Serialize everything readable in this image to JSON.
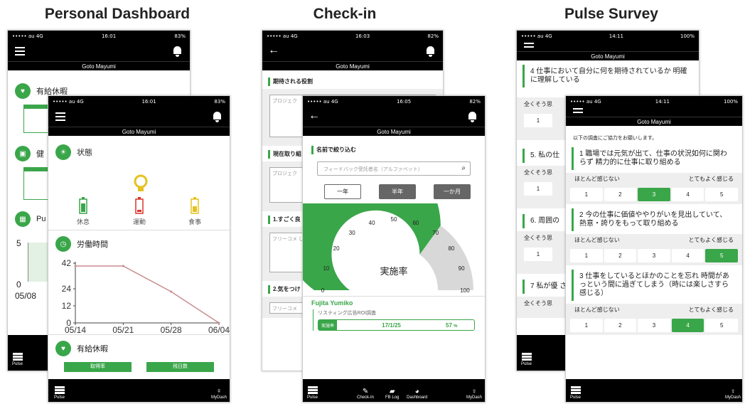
{
  "titles": {
    "left": "Personal Dashboard",
    "mid": "Check-in",
    "right": "Pulse Survey"
  },
  "status": {
    "carrier": "••••• au  4G",
    "time_a": "16:01",
    "bat_a": "83%",
    "time_c": "16:03",
    "bat_c": "82%",
    "time_d": "16:05",
    "bat_d": "82%",
    "time_e": "14:11",
    "bat_e": "100%"
  },
  "user": "Goto Mayumi",
  "dash_back": {
    "sec1": "有給休暇",
    "sec2": "健",
    "y_labels": [
      "5",
      "0"
    ],
    "x_label": "05/08",
    "tab": "Pu",
    "foot": "Pulse"
  },
  "dash": {
    "sec_state": "状態",
    "states": [
      {
        "label": "休息",
        "color": "#3aa64a"
      },
      {
        "label": "運動",
        "color": "#d9342b"
      },
      {
        "label": "食事",
        "color": "#e6c21f"
      }
    ],
    "sec_hours": "労働時間",
    "sec_leave": "有給休暇",
    "leave_btns": [
      "取得率",
      "残日数"
    ],
    "foot_left": "Pulse",
    "foot_right": "MyDash"
  },
  "chart_data": {
    "type": "line",
    "x": [
      "05/14",
      "05/21",
      "05/28",
      "06/04"
    ],
    "values": [
      40,
      40,
      22,
      0
    ],
    "y_ticks": [
      "42",
      "24",
      "12",
      "0"
    ],
    "ylim": [
      0,
      42
    ],
    "grid": false,
    "title": "",
    "xlabel": "",
    "ylabel": ""
  },
  "checkin_back": {
    "role": "期待される役割",
    "role_text": "プロジェク",
    "current": "現在取り組",
    "current_text": "プロジェク",
    "q1": "1.すごく良",
    "q1_text": "フリーコメ した内容を",
    "q2": "2.気をつけ",
    "q2_text": "フリーコメ"
  },
  "checkin": {
    "filter_title": "名前で絞り込む",
    "search_placeholder": "フィードバック受託者名（アルファベット）",
    "period_btns": [
      "一年",
      "半年",
      "一か月"
    ],
    "gauge_label": "実施率",
    "gauge_value": 70,
    "gauge_ticks": [
      "0",
      "10",
      "20",
      "30",
      "40",
      "50",
      "60",
      "70",
      "80",
      "90",
      "100"
    ],
    "person": "Fujita Yumiko",
    "project": "リスティング広告ROI調査",
    "row_label": "実施率",
    "row_date": "17/1/25",
    "row_pct": "57",
    "row_unit": "%",
    "foot": [
      "Pulse",
      "Check-In",
      "FB Log",
      "Dashboard",
      "MyDash"
    ]
  },
  "pulse_back": {
    "q4": "4 仕事において自分に何を期待されているか 明確に理解している",
    "scale_left": "全くそう思",
    "q5": "5. 私の仕",
    "q6": "6. 周囲の",
    "q7": "7 私が優 される",
    "foot": "Pulse",
    "one": "1"
  },
  "pulse": {
    "intro": "以下の調査にご協力をお願いします。",
    "low": "ほとんど感じない",
    "high": "とてもよく感じる",
    "questions": [
      {
        "text": "1 職場では元気が出て、仕事の状況如何に関わらず 精力的に仕事に取り組める",
        "sel": 3
      },
      {
        "text": "2 今の仕事に価値ややりがいを見出していて、熱意・誇りをもって取り組める",
        "sel": 5
      },
      {
        "text": "3 仕事をしているとほかのことを忘れ 時間があっという間に過ぎてしまう（時には楽しさすら感じる）",
        "sel": 4
      }
    ],
    "foot_left": "Pulse",
    "foot_right": "MyDash"
  },
  "colors": {
    "green": "#3aa64a",
    "gray": "#d8d8d8",
    "red": "#d9342b",
    "yellow": "#e6c21f",
    "line": "#c88c90"
  }
}
